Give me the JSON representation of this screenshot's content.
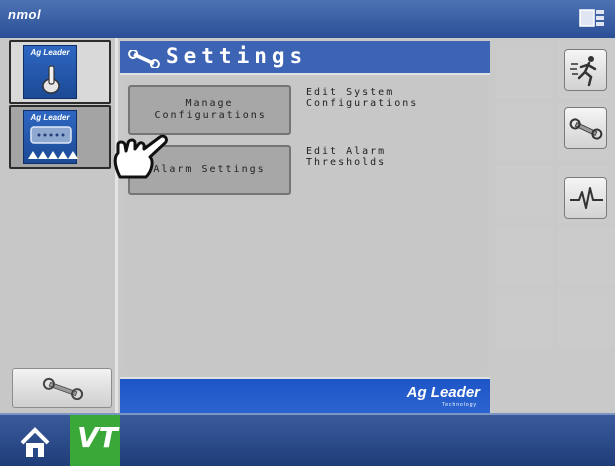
{
  "topbar": {
    "logo_text": "nmol"
  },
  "left_column": {
    "modules": [
      {
        "brand": "Ag Leader"
      },
      {
        "brand": "Ag Leader"
      }
    ]
  },
  "panel": {
    "title": "Settings",
    "buttons": [
      {
        "label": "Manage Configurations",
        "description": "Edit System\nConfigurations"
      },
      {
        "label": "Alarm Settings",
        "description": "Edit Alarm\nThresholds"
      }
    ],
    "footer_brand": "Ag Leader",
    "footer_sub": "Technology"
  },
  "bottombar": {
    "vt_label": "VT"
  },
  "colors": {
    "accent_blue": "#3d63b4",
    "vt_green": "#39a839"
  }
}
